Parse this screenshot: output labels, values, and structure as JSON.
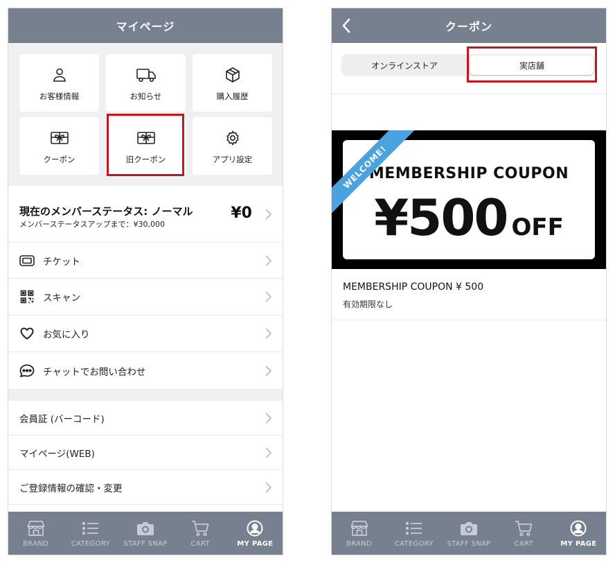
{
  "left": {
    "header_title": "マイページ",
    "tiles": [
      {
        "label": "お客様情報",
        "icon": "person-icon"
      },
      {
        "label": "お知らせ",
        "icon": "truck-icon"
      },
      {
        "label": "購入履歴",
        "icon": "box-icon"
      },
      {
        "label": "クーポン",
        "icon": "gift-icon"
      },
      {
        "label": "旧クーポン",
        "icon": "gift-icon"
      },
      {
        "label": "アプリ設定",
        "icon": "gear-icon"
      }
    ],
    "status": {
      "title": "現在のメンバーステータス: ノーマル",
      "subtitle": "メンバーステータスアップまで：¥30,000",
      "points": "¥0"
    },
    "menu": [
      {
        "label": "チケット",
        "icon": "ticket-icon"
      },
      {
        "label": "スキャン",
        "icon": "qr-code-icon"
      },
      {
        "label": "お気に入り",
        "icon": "heart-icon"
      },
      {
        "label": "チャットでお問い合わせ",
        "icon": "chat-icon"
      }
    ],
    "menu2": [
      {
        "label": "会員証 (バーコード)"
      },
      {
        "label": "マイページ(WEB)"
      },
      {
        "label": "ご登録情報の確認・変更"
      }
    ]
  },
  "right": {
    "header_title": "クーポン",
    "segments": [
      "オンラインストア",
      "実店舗"
    ],
    "active_segment": 1,
    "banner": {
      "ribbon": "WELCOME!",
      "title": "MEMBERSHIP COUPON",
      "amount": "¥500",
      "off": "OFF"
    },
    "coupon": {
      "name": "MEMBERSHIP COUPON ¥ 500",
      "expiry": "有効期限なし"
    }
  },
  "tabbar": {
    "items": [
      {
        "label": "BRAND",
        "icon": "store-icon"
      },
      {
        "label": "CATEGORY",
        "icon": "list-icon"
      },
      {
        "label": "STAFF SNAP",
        "icon": "camera-icon"
      },
      {
        "label": "CART",
        "icon": "cart-icon"
      },
      {
        "label": "MY PAGE",
        "icon": "user-circle-icon"
      }
    ],
    "active_index": 4
  },
  "colors": {
    "header": "#76808f",
    "highlight": "#c0161d",
    "ribbon": "#4aa3df"
  }
}
